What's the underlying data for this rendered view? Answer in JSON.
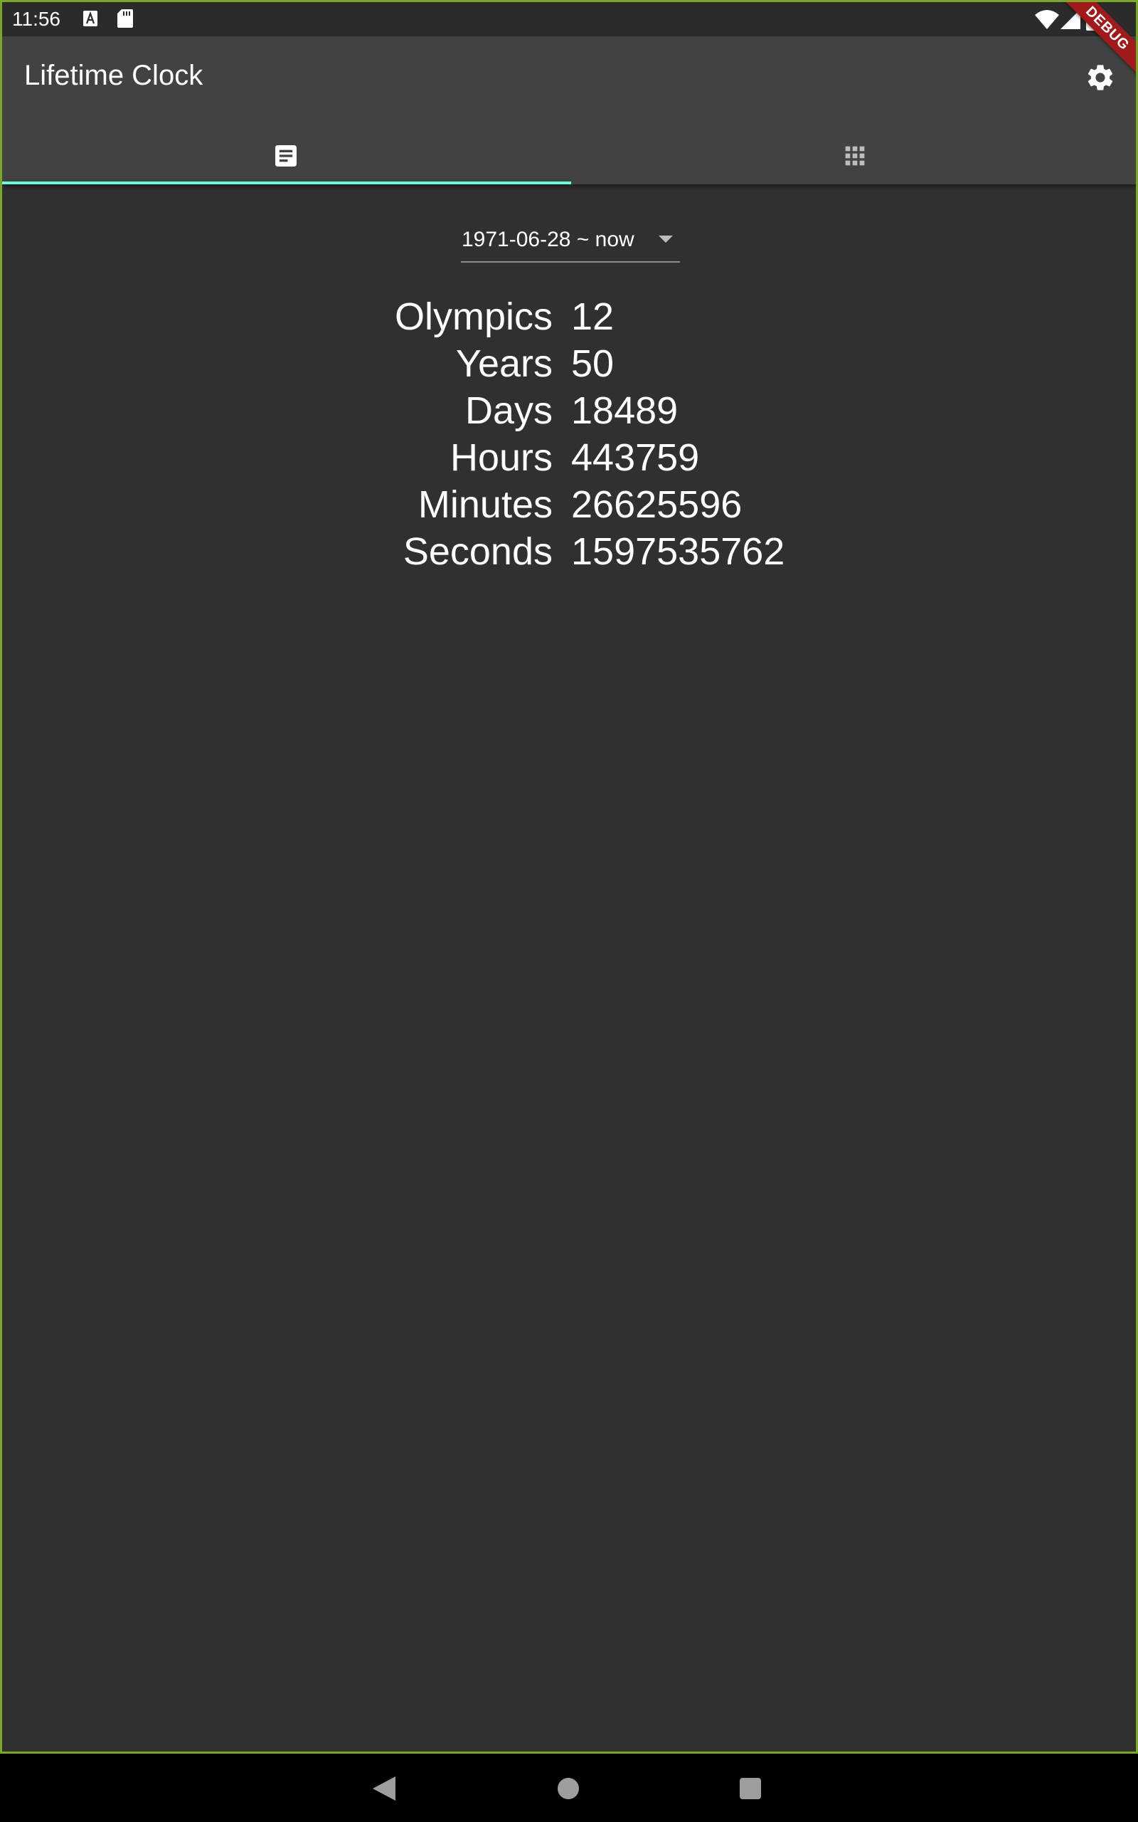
{
  "status_bar": {
    "time": "11:56",
    "icons": [
      "a-notification-icon",
      "sd-card-icon",
      "wifi-icon",
      "signal-icon",
      "battery-icon"
    ]
  },
  "app_bar": {
    "title": "Lifetime Clock",
    "settings_icon": "gear-icon",
    "tabs": [
      {
        "icon": "list-view-icon",
        "selected": true
      },
      {
        "icon": "grid-view-icon",
        "selected": false
      }
    ],
    "indicator_color": "#64ffda"
  },
  "debug_banner": "DEBUG",
  "range_selector": {
    "value": "1971-06-28 ~ now"
  },
  "stats": [
    {
      "label": "Olympics",
      "value": "12"
    },
    {
      "label": "Years",
      "value": "50"
    },
    {
      "label": "Days",
      "value": "18489"
    },
    {
      "label": "Hours",
      "value": "443759"
    },
    {
      "label": "Minutes",
      "value": "26625596"
    },
    {
      "label": "Seconds",
      "value": "1597535762"
    }
  ],
  "nav_bar": {
    "icons": [
      "back-icon",
      "home-icon",
      "recents-icon"
    ]
  },
  "colors": {
    "background": "#303030",
    "app_bar": "#424242",
    "accent": "#64ffda",
    "debug": "#a01a1a"
  }
}
